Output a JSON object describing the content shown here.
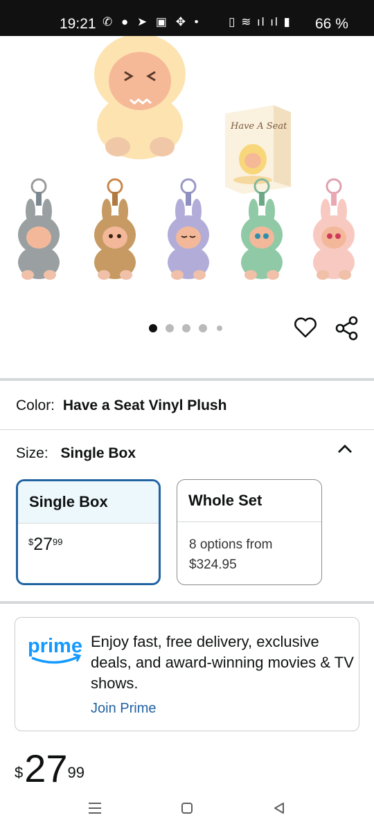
{
  "status_bar": {
    "time": "19:21",
    "battery": "66 %"
  },
  "gallery": {
    "image_count": 5,
    "active_index": 0,
    "box_text": "Have A Seat",
    "figure_colors": [
      "#9aa0a2",
      "#c69a62",
      "#b1add8",
      "#8fc9a6",
      "#f7c9c1"
    ]
  },
  "color": {
    "label": "Color:",
    "value": "Have a Seat Vinyl Plush"
  },
  "size": {
    "label": "Size:",
    "value": "Single Box"
  },
  "size_options": [
    {
      "title": "Single Box",
      "price_symbol": "$",
      "price_whole": "27",
      "price_cents": "99",
      "selected": true
    },
    {
      "title": "Whole Set",
      "line1": "8 options from",
      "line2": "$324.95",
      "selected": false
    }
  ],
  "prime": {
    "logo_text": "prime",
    "text": "Enjoy fast, free delivery, exclusive deals, and award-winning movies & TV shows.",
    "link": "Join Prime"
  },
  "price": {
    "symbol": "$",
    "whole": "27",
    "cents": "99"
  },
  "colors": {
    "accent_blue": "#2162a1",
    "prime_blue": "#1399ff",
    "selected_bg": "#edf8fd"
  }
}
